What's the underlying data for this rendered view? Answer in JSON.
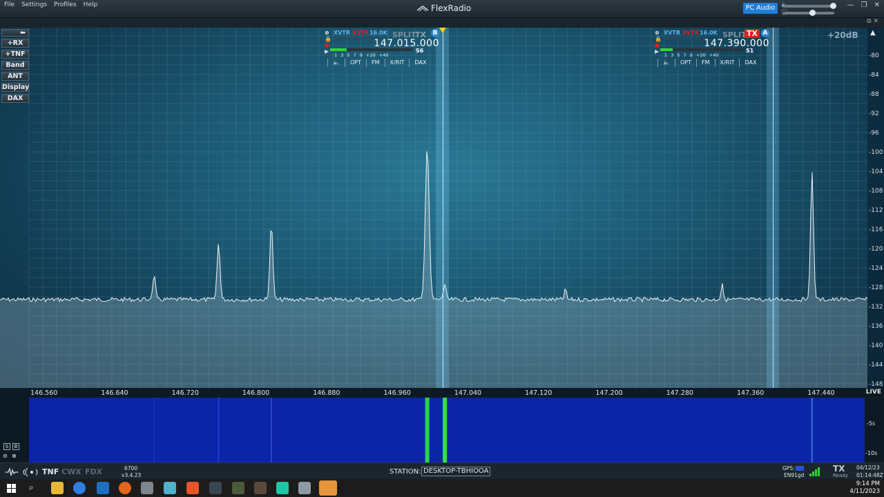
{
  "titlebar": {
    "menu": [
      "File",
      "Settings",
      "Profiles",
      "Help"
    ],
    "brand": "FlexRadio",
    "pc_audio": "PC Audio",
    "window_controls": [
      "—",
      "❐",
      "✕"
    ]
  },
  "left_buttons": [
    "+RX",
    "+TNF",
    "Band",
    "ANT",
    "Display",
    "DAX"
  ],
  "panadapter": {
    "top_db": "+20dB",
    "db_ticks": [
      "-80",
      "-84",
      "-88",
      "-92",
      "-96",
      "-100",
      "-104",
      "-108",
      "-112",
      "-116",
      "-120",
      "-124",
      "-128",
      "-132",
      "-136",
      "-140",
      "-144",
      "-148"
    ],
    "freq_ticks": [
      "146.560",
      "146.640",
      "146.720",
      "146.800",
      "146.880",
      "146.960",
      "147.040",
      "147.120",
      "147.200",
      "147.280",
      "147.360",
      "147.440"
    ],
    "live": "LIVE",
    "signal_peaks_mhz": [
      146.685,
      146.758,
      146.818,
      146.995,
      147.015,
      147.152,
      147.33,
      147.432
    ]
  },
  "slice_b": {
    "xvtr_label": "XVTR",
    "xvtr_red": "XVTR",
    "bw": "16.0K",
    "sub": "NB NR ANF QSK",
    "split": "SPLIT",
    "tx": "TX",
    "letter": "B",
    "frequency": "147.015.000",
    "s_level": "S6",
    "meter_scale": "1 3 5 7 9 +20 +40",
    "buttons": [
      "OPT",
      "FM",
      "X/RIT",
      "DAX"
    ]
  },
  "slice_a": {
    "xvtr_label": "XVTR",
    "xvtr_red": "XVTR",
    "bw": "16.0K",
    "sub": "NB NR ANF QSK",
    "split": "SPLIT",
    "tx": "TX",
    "letter": "A",
    "frequency": "147.390.000",
    "s_level": "S1",
    "meter_scale": "1 3 5 7 9 +20 +40",
    "buttons": [
      "OPT",
      "FM",
      "X/RIT",
      "DAX"
    ]
  },
  "waterfall": {
    "s_label": "S",
    "b_label": "B",
    "t5": "-5s",
    "t10": "-10s"
  },
  "status": {
    "tnf": "TNF",
    "cwx": "CWX",
    "fdx": "FDX",
    "model": "6700",
    "version": "v3.4.23",
    "station_label": "STATION:",
    "station": "DESKTOP-TBHIOOA",
    "gps": "GPS:",
    "grid": "EN91gd",
    "tx": "TX",
    "ready": "Ready",
    "date": "04/12/23",
    "utc": "01:14:48Z"
  },
  "taskbar": {
    "time": "9:14 PM",
    "date": "4/11/2023"
  },
  "colors": {
    "accent": "#1e7fd8",
    "tx_red": "#e01e1e",
    "meter_green": "#2fd62f",
    "waterfall_blue": "#0c24a6"
  }
}
